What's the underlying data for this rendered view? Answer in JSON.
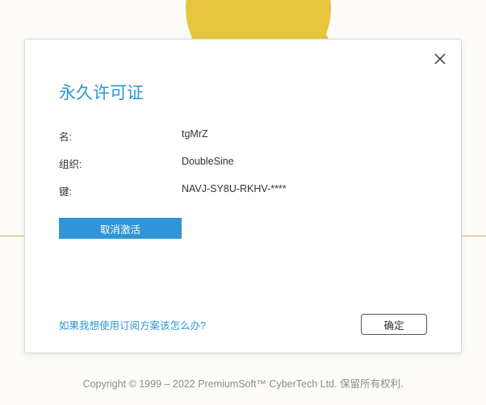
{
  "dialog": {
    "title": "永久许可证",
    "fields": {
      "name_label": "名:",
      "name_value": "tgMrZ",
      "org_label": "组织:",
      "org_value": "DoubleSine",
      "key_label": "键:",
      "key_value": "NAVJ-SY8U-RKHV-****"
    },
    "deactivate_button": "取消激活",
    "subscription_link": "如果我想使用订阅方案该怎么办?",
    "ok_button": "确定"
  },
  "footer": {
    "copyright": "Copyright © 1999 – 2022 PremiumSoft™ CyberTech Ltd. 保留所有权利."
  }
}
